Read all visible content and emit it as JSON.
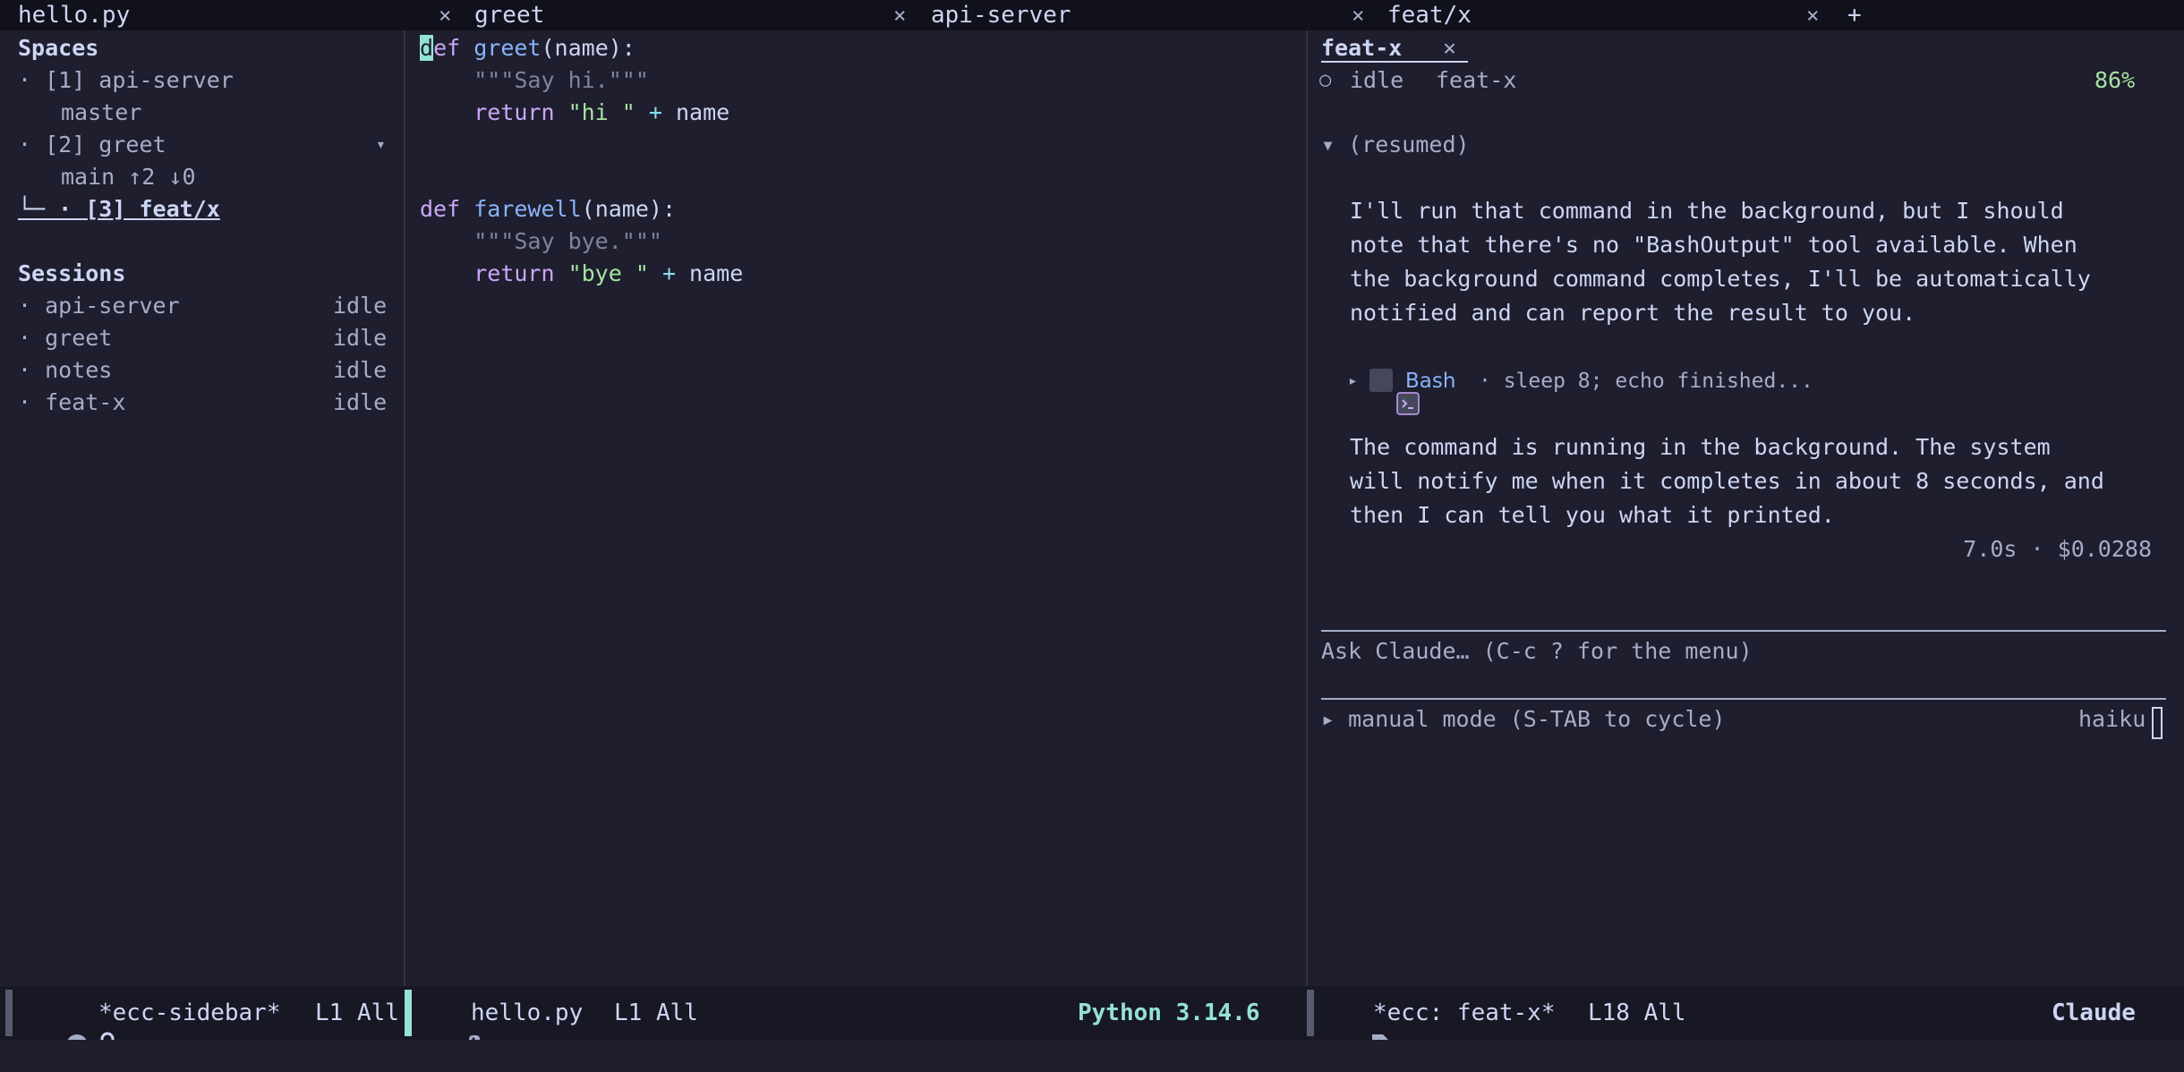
{
  "tabs": [
    {
      "label": "hello.py",
      "close": "×"
    },
    {
      "label": "greet",
      "close": "×"
    },
    {
      "label": "api-server",
      "close": "×"
    },
    {
      "label": "feat/x",
      "close": "×"
    }
  ],
  "new_tab": "+",
  "sidebar": {
    "spaces_heading": "Spaces",
    "spaces": [
      {
        "text": "· [1] api-server"
      },
      {
        "text": "master"
      },
      {
        "text": "· [2] greet",
        "toggle": "▾"
      },
      {
        "text": "main ↑2 ↓0"
      },
      {
        "text": "└─ · [3] feat/x"
      }
    ],
    "sessions_heading": "Sessions",
    "sessions": [
      {
        "name": "· api-server",
        "status": "idle"
      },
      {
        "name": "· greet",
        "status": "idle"
      },
      {
        "name": "· notes",
        "status": "idle"
      },
      {
        "name": "· feat-x",
        "status": "idle"
      }
    ]
  },
  "editor": {
    "lines": [
      {
        "parts": [
          [
            "cur",
            "d"
          ],
          [
            "kw",
            "ef "
          ],
          [
            "fn",
            "greet"
          ],
          [
            "plain",
            "(name):"
          ]
        ]
      },
      {
        "parts": [
          [
            "doc",
            "    \"\"\"Say hi.\"\"\""
          ]
        ]
      },
      {
        "parts": [
          [
            "kw",
            "    return "
          ],
          [
            "str",
            "\"hi \""
          ],
          [
            "op",
            " + "
          ],
          [
            "plain",
            "name"
          ]
        ]
      },
      {
        "parts": []
      },
      {
        "parts": []
      },
      {
        "parts": [
          [
            "kw",
            "def "
          ],
          [
            "fn",
            "farewell"
          ],
          [
            "plain",
            "(name):"
          ]
        ]
      },
      {
        "parts": [
          [
            "doc",
            "    \"\"\"Say bye.\"\"\""
          ]
        ]
      },
      {
        "parts": [
          [
            "kw",
            "    return "
          ],
          [
            "str",
            "\"bye \""
          ],
          [
            "op",
            " + "
          ],
          [
            "plain",
            "name"
          ]
        ]
      }
    ]
  },
  "claude": {
    "tab_label": "feat-x",
    "tab_close": "×",
    "status_circle": "○",
    "status": "idle",
    "session": "feat-x",
    "percent": "86%",
    "resumed": "▾ (resumed)",
    "message1": [
      "I'll run that command in the background, but I should",
      "note that there's no \"BashOutput\" tool available. When",
      "the background command completes, I'll be automatically",
      "notified and can report the result to you."
    ],
    "tool_arrow": "▸",
    "tool_name": "Bash",
    "tool_detail": "· sleep 8; echo finished...",
    "message2": [
      "The command is running in the background. The system",
      "will notify me when it completes in about 8 seconds, and",
      "then I can tell you what it printed."
    ],
    "stats": "7.0s · $0.0288",
    "input_placeholder": "Ask Claude… (C-c ? for the menu)",
    "mode": "▸ manual mode (S-TAB to cycle)",
    "model": "haiku"
  },
  "modeline": {
    "left_buffer": "*ecc-sidebar*",
    "left_pos": "L1 All",
    "mid_buffer": "hello.py",
    "mid_pos": "L1 All",
    "mid_mode": "Python 3.14.6",
    "right_buffer": "*ecc: feat-x*",
    "right_pos": "L18 All",
    "right_mode": "Claude"
  },
  "colors": {
    "bg": "#1e1e2e",
    "accent_teal": "#94e2d5",
    "keyword": "#cba6f7",
    "function": "#89b4fa",
    "string": "#a6e3a1"
  }
}
